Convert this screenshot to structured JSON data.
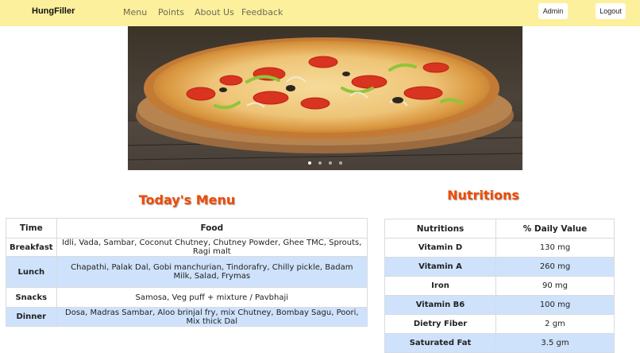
{
  "navbar": {
    "brand": "HungFiller",
    "links": [
      "Menu",
      "Points",
      "About Us",
      "Feedback"
    ],
    "admin_label": "Admin",
    "logout_label": "Logout",
    "bg_color": "#fdf09c"
  },
  "carousel": {
    "image": "pizza",
    "slide_count": 4,
    "active_slide": 1
  },
  "menu": {
    "title": "Today's Menu",
    "headers": [
      "Time",
      "Food"
    ],
    "rows": [
      {
        "time": "Breakfast",
        "food": "Idli, Vada, Sambar, Coconut Chutney, Chutney Powder, Ghee TMC, Sprouts, Ragi malt"
      },
      {
        "time": "Lunch",
        "food": "Chapathi, Palak Dal, Gobi manchurian, Tindorafry, Chilly pickle, Badam Milk, Salad, Frymas"
      },
      {
        "time": "Snacks",
        "food": "Samosa, Veg puff + mixture / Pavbhaji"
      },
      {
        "time": "Dinner",
        "food": "Dosa, Madras Sambar, Aloo brinjal fry, mix Chutney, Bombay Sagu, Poori, Mix thick Dal"
      }
    ]
  },
  "nutrition": {
    "title": "Nutritions",
    "headers": [
      "Nutritions",
      "% Daily Value"
    ],
    "rows": [
      {
        "name": "Vitamin D",
        "value": "130 mg"
      },
      {
        "name": "Vitamin A",
        "value": "260 mg"
      },
      {
        "name": "Iron",
        "value": "90 mg"
      },
      {
        "name": "Vitamin B6",
        "value": "100 mg"
      },
      {
        "name": "Dietry Fiber",
        "value": "2 gm"
      },
      {
        "name": "Saturated Fat",
        "value": "3.5 gm"
      }
    ]
  },
  "colors": {
    "heading": "#f04a00",
    "row_highlight": "#cfe2fb"
  }
}
